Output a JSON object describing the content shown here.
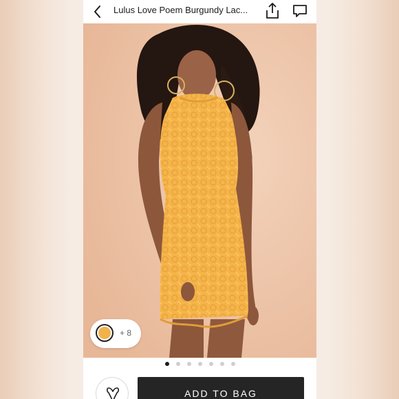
{
  "header": {
    "title": "Lulus Love Poem Burgundy Lac...",
    "back_icon": "chevron-left-icon",
    "share_icon": "share-icon",
    "comment_icon": "comment-icon"
  },
  "product_image": {
    "dress_color": "#f6b64c"
  },
  "colors": {
    "selected_swatch": "#f2b24a",
    "more_label": "+ 8"
  },
  "carousel": {
    "total_pages": 7,
    "current_page": 1
  },
  "actions": {
    "love_icon": "heart-v-icon",
    "add_to_bag_label": "ADD TO BAG"
  }
}
